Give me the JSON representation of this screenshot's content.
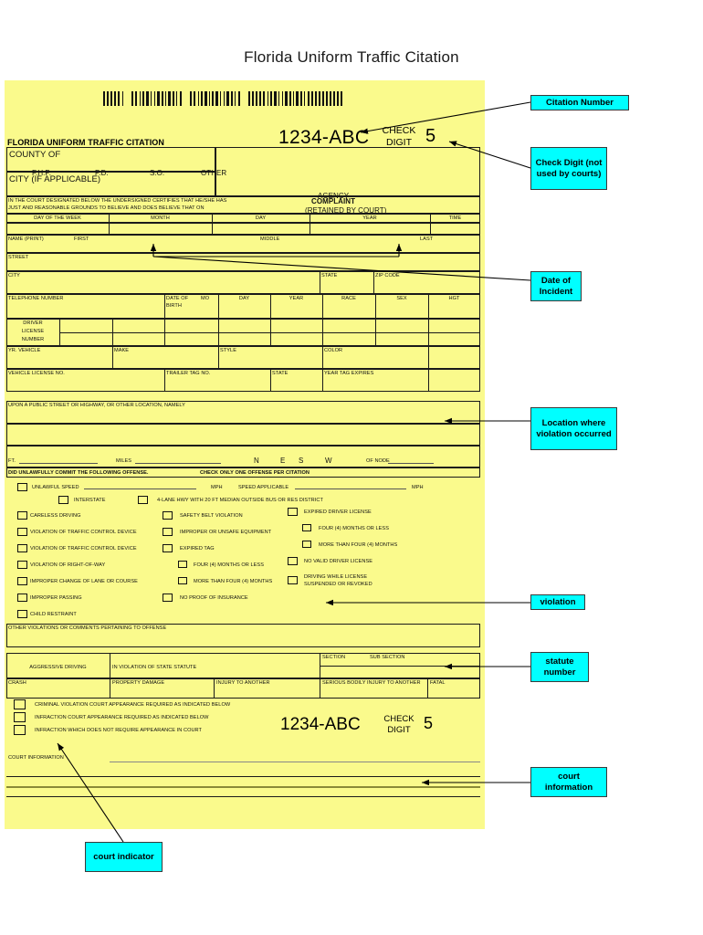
{
  "page": {
    "title": "Florida Uniform Traffic Citation"
  },
  "citation": {
    "header_label": "FLORIDA UNIFORM TRAFFIC CITATION",
    "number": "1234-ABC",
    "check_label_line1": "CHECK",
    "check_label_line2": "DIGIT",
    "check_digit": "5",
    "barcode_groups": [
      6,
      14,
      14,
      26
    ]
  },
  "agency_block": {
    "county_of": "COUNTY OF",
    "city_if_applicable": "CITY (IF APPLICABLE)",
    "agency_options": [
      "F.H.P.",
      "P.D.",
      "S.O.",
      "OTHER"
    ],
    "agency_label": "AGENCY"
  },
  "complaint_block": {
    "certify_line1": "IN THE COURT DESIGNATED BELOW THE UNDERSIGNED CERTIFIES THAT HE/SHE HAS",
    "certify_line2": "JUST AND REASONABLE GROUNDS TO BELIEVE AND DOES BELIEVE THAT ON",
    "complaint": "COMPLAINT",
    "retained": "(RETAINED BY COURT)",
    "date_headers": [
      "DAY OF THE WEEK",
      "MONTH",
      "DAY",
      "YEAR",
      "TIME"
    ]
  },
  "person_block": {
    "name_print": "NAME (PRINT)",
    "first": "FIRST",
    "middle": "MIDDLE",
    "last": "LAST",
    "street": "STREET",
    "city": "CITY",
    "state": "STATE",
    "zip_code": "ZIP CODE",
    "telephone_number": "TELEPHONE NUMBER",
    "date_of_birth_line1": "DATE OF",
    "date_of_birth_line2": "BIRTH",
    "mo": "MO",
    "day": "DAY",
    "year": "YEAR",
    "race": "RACE",
    "sex": "SEX",
    "hgt": "HGT",
    "dl_line1": "DRIVER",
    "dl_line2": "LICENSE",
    "dl_line3": "NUMBER"
  },
  "vehicle_block": {
    "yr_vehicle": "YR. VEHICLE",
    "make": "MAKE",
    "style": "STYLE",
    "color": "COLOR",
    "vehicle_license_no": "VEHICLE LICENSE NO.",
    "trailer_tag_no": "TRAILER TAG NO.",
    "state": "STATE",
    "year_tag_expires": "YEAR TAG EXPIRES"
  },
  "location_block": {
    "heading": "UPON A PUBLIC STREET OR HIGHWAY, OR OTHER LOCATION, NAMELY",
    "ft": "FT.",
    "miles": "MILES",
    "directions": [
      "N",
      "E",
      "S",
      "W"
    ],
    "of_node": "OF NODE"
  },
  "offense_block": {
    "heading_left": "DID UNLAWFULLY COMMIT THE FOLLOWING OFFENSE.",
    "heading_right": "CHECK ONLY ONE OFFENSE PER CITATION",
    "unlawful_speed": "UNLAWFUL SPEED",
    "mph": "MPH",
    "speed_applicable": "SPEED APPLICABLE",
    "mph2": "MPH",
    "interstate": "INTERSTATE",
    "four_lane": "4-LANE HWY WITH 20 FT MEDIAN OUTSIDE BUS OR RES DISTRICT",
    "column1": [
      "CARELESS DRIVING",
      "VIOLATION OF TRAFFIC CONTROL DEVICE",
      "VIOLATION OF TRAFFIC CONTROL DEVICE",
      "VIOLATION OF RIGHT-OF-WAY",
      "IMPROPER CHANGE OF LANE OR COURSE",
      "IMPROPER PASSING",
      "CHILD RESTRAINT"
    ],
    "column2": [
      "SAFETY BELT VIOLATION",
      "IMPROPER OR UNSAFE EQUIPMENT",
      "EXPIRED TAG",
      "FOUR (4) MONTHS OR LESS",
      "MORE THAN FOUR (4) MONTHS",
      "NO PROOF OF INSURANCE"
    ],
    "column3": [
      "EXPIRED DRIVER LICENSE",
      "FOUR (4) MONTHS OR LESS",
      "MORE THAN FOUR (4) MONTHS",
      "NO VALID DRIVER LICENSE",
      "DRIVING WHILE LICENSE",
      "SUSPENDED OR REVOKED"
    ],
    "other_violations": "OTHER VIOLATIONS OR COMMENTS PERTAINING TO OFFENSE"
  },
  "statute_block": {
    "aggressive_driving": "AGGRESSIVE DRIVING",
    "in_violation_of_state_statute": "IN VIOLATION OF STATE STATUTE",
    "section": "SECTION",
    "sub_section": "SUB SECTION",
    "crash": "CRASH",
    "property_damage": "PROPERTY DAMAGE",
    "injury_to_another": "INJURY TO ANOTHER",
    "serious_bodily_injury": "SERIOUS BODILY INJURY TO ANOTHER",
    "fatal": "FATAL"
  },
  "appearance_block": {
    "options": [
      "CRIMINAL VIOLATION COURT APPEARANCE REQUIRED AS INDICATED BELOW",
      "INFRACTION COURT APPEARANCE REQUIRED AS INDICATED BELOW",
      "INFRACTION WHICH DOES NOT REQUIRE APPEARANCE IN COURT"
    ]
  },
  "court_block": {
    "court_information": "COURT INFORMATION"
  },
  "annotations": [
    {
      "id": "citation-number",
      "text": "Citation Number"
    },
    {
      "id": "check-digit",
      "text": "Check Digit (not used by courts)"
    },
    {
      "id": "date-of-incident",
      "text": "Date of Incident"
    },
    {
      "id": "location",
      "text": "Location where violation occurred"
    },
    {
      "id": "violation",
      "text": "violation"
    },
    {
      "id": "statute-number",
      "text": "statute number"
    },
    {
      "id": "court-information",
      "text": "court information"
    },
    {
      "id": "court-indicator",
      "text": "court indicator"
    }
  ],
  "colors": {
    "form_background": "#FAFA8C",
    "callout_background": "#00FFFF",
    "ink": "#1A1A1A"
  }
}
